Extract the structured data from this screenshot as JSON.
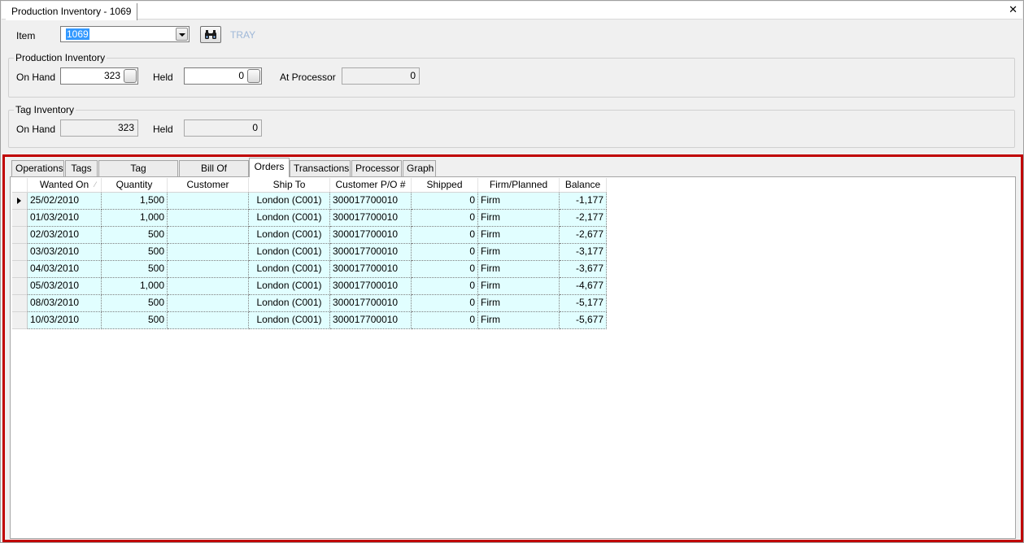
{
  "window": {
    "doc_tab_title": "Production Inventory - 1069",
    "close_glyph": "✕"
  },
  "item": {
    "label": "Item",
    "value": "1069",
    "find_icon": "binoculars-icon",
    "tray_label": "TRAY"
  },
  "production_inventory": {
    "title": "Production Inventory",
    "on_hand_label": "On Hand",
    "on_hand_value": "323",
    "held_label": "Held",
    "held_value": "0",
    "at_processor_label": "At Processor",
    "at_processor_value": "0"
  },
  "tag_inventory": {
    "title": "Tag Inventory",
    "on_hand_label": "On Hand",
    "on_hand_value": "323",
    "held_label": "Held",
    "held_value": "0"
  },
  "tabs": [
    {
      "label": "Operations"
    },
    {
      "label": "Tags"
    },
    {
      "label": "Tag Transactions"
    },
    {
      "label": "Bill Of Material"
    },
    {
      "label": "Orders"
    },
    {
      "label": "Transactions"
    },
    {
      "label": "Processor"
    },
    {
      "label": "Graph"
    }
  ],
  "active_tab": "Orders",
  "orders_grid": {
    "columns": [
      "Wanted On",
      "Quantity",
      "Customer",
      "Ship To",
      "Customer P/O #",
      "Shipped",
      "Firm/Planned",
      "Balance"
    ],
    "rows": [
      [
        "25/02/2010",
        "1,500",
        "",
        "London (C001)",
        "300017700010",
        "0",
        "Firm",
        "-1,177"
      ],
      [
        "01/03/2010",
        "1,000",
        "",
        "London (C001)",
        "300017700010",
        "0",
        "Firm",
        "-2,177"
      ],
      [
        "02/03/2010",
        "500",
        "",
        "London (C001)",
        "300017700010",
        "0",
        "Firm",
        "-2,677"
      ],
      [
        "03/03/2010",
        "500",
        "",
        "London (C001)",
        "300017700010",
        "0",
        "Firm",
        "-3,177"
      ],
      [
        "04/03/2010",
        "500",
        "",
        "London (C001)",
        "300017700010",
        "0",
        "Firm",
        "-3,677"
      ],
      [
        "05/03/2010",
        "1,000",
        "",
        "London (C001)",
        "300017700010",
        "0",
        "Firm",
        "-4,677"
      ],
      [
        "08/03/2010",
        "500",
        "",
        "London (C001)",
        "300017700010",
        "0",
        "Firm",
        "-5,177"
      ],
      [
        "10/03/2010",
        "500",
        "",
        "London (C001)",
        "300017700010",
        "0",
        "Firm",
        "-5,677"
      ]
    ]
  },
  "colors": {
    "highlight_border": "#c00000",
    "row_background": "#e1feff",
    "selection": "#3399ff"
  }
}
